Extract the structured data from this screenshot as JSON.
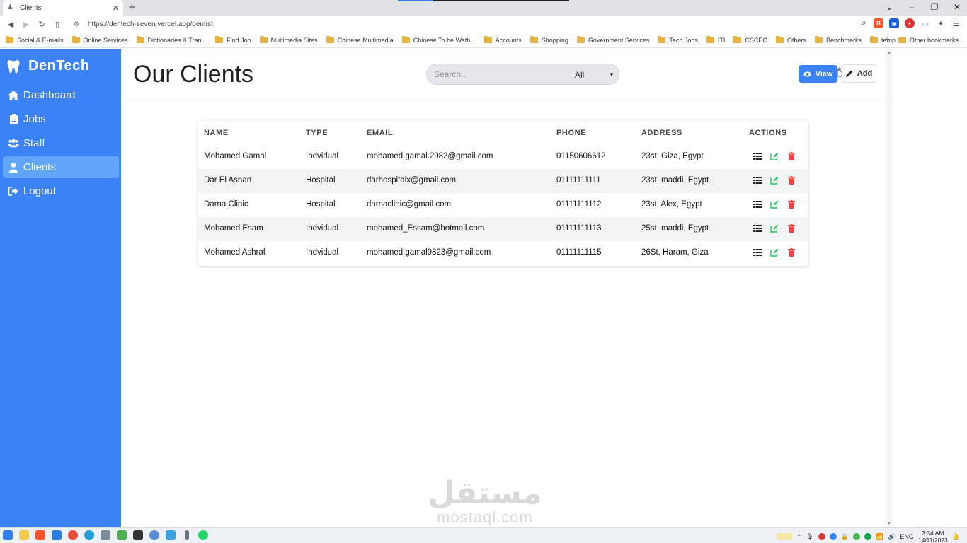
{
  "browser": {
    "tab_title": "Clients",
    "new_tab": "+",
    "url": "https://dentech-seven.vercel.app/dentist",
    "bookmarks": [
      "Social & E-mails",
      "Online Services",
      "Dictionaries & Tran...",
      "Find Job",
      "Multimedia Sites",
      "Chinese Multimedia",
      "Chinese To be Wath...",
      "Accounts",
      "Shopping",
      "Government Services",
      "Tech Jobs",
      "ITI",
      "CSCEC",
      "Others",
      "Benchmarks",
      "temp"
    ],
    "more": "»",
    "other_bookmarks": "Other bookmarks"
  },
  "sidebar": {
    "brand": "DenTech",
    "items": [
      {
        "label": "Dashboard",
        "icon": "home-icon"
      },
      {
        "label": "Jobs",
        "icon": "clipboard-icon"
      },
      {
        "label": "Staff",
        "icon": "users-icon"
      },
      {
        "label": "Clients",
        "icon": "user-icon"
      },
      {
        "label": "Logout",
        "icon": "logout-icon"
      }
    ],
    "active": "Clients"
  },
  "header": {
    "title": "Our Clients",
    "search_placeholder": "Search...",
    "filter_value": "All",
    "view_label": "View",
    "add_label": "Add"
  },
  "table": {
    "columns": [
      "NAME",
      "TYPE",
      "EMAIL",
      "PHONE",
      "ADDRESS",
      "ACTIONS"
    ],
    "rows": [
      {
        "name": "Mohamed Gamal",
        "type": "Indvidual",
        "email": "mohamed.gamal.2982@gmail.com",
        "phone": "01150606612",
        "address": "23st, Giza, Egypt"
      },
      {
        "name": "Dar El Asnan",
        "type": "Hospital",
        "email": "darhospitalx@gmail.com",
        "phone": "01111111111",
        "address": "23st, maddi, Egypt"
      },
      {
        "name": "Darna Clinic",
        "type": "Hospital",
        "email": "darnaclinic@gmail.com",
        "phone": "01111111112",
        "address": "23st, Alex, Egypt"
      },
      {
        "name": "Mohamed Esam",
        "type": "Indvidual",
        "email": "mohamed_Essam@hotmail.com",
        "phone": "01111111113",
        "address": "25st, maddi, Egypt"
      },
      {
        "name": "Mohamed Ashraf",
        "type": "Indvidual",
        "email": "mohamed.gamal9823@gmail.com",
        "phone": "01111111115",
        "address": "26St, Haram, Giza"
      }
    ]
  },
  "watermark": {
    "arabic": "مستقل",
    "latin": "mostaql.com"
  },
  "taskbar": {
    "lang": "ENG",
    "time": "3:34 AM",
    "date": "14/11/2023"
  },
  "colors": {
    "primary": "#3b82f6",
    "active_nav": "#60a5fa",
    "edit": "#22c55e",
    "delete": "#ef4444"
  }
}
